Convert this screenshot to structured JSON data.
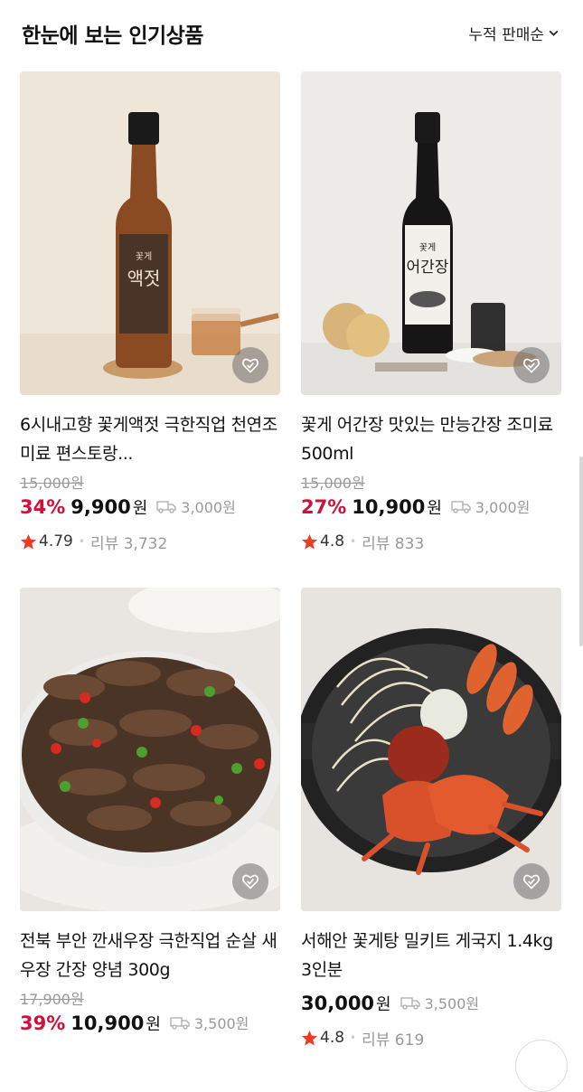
{
  "header": {
    "title": "한눈에 보는 인기상품",
    "sort_label": "누적 판매순"
  },
  "products": [
    {
      "name": "6시내고향 꽃게액젓 극한직업 천연조미료 편스토랑...",
      "original_price": "15,000원",
      "discount": "34%",
      "price": "9,900",
      "currency": "원",
      "shipping": "3,000원",
      "rating": "4.79",
      "reviews": "리뷰 3,732"
    },
    {
      "name": "꽃게 어간장 맛있는 만능간장 조미료 500ml",
      "original_price": "15,000원",
      "discount": "27%",
      "price": "10,900",
      "currency": "원",
      "shipping": "3,000원",
      "rating": "4.8",
      "reviews": "리뷰 833"
    },
    {
      "name": "전북 부안 깐새우장 극한직업 순살 새우장 간장 양념 300g",
      "original_price": "17,900원",
      "discount": "39%",
      "price": "10,900",
      "currency": "원",
      "shipping": "3,500원",
      "rating": "",
      "reviews": ""
    },
    {
      "name": "서해안 꽃게탕 밀키트 게국지 1.4kg 3인분",
      "original_price": "",
      "discount": "",
      "price": "30,000",
      "currency": "원",
      "shipping": "3,500원",
      "rating": "4.8",
      "reviews": "리뷰 619"
    }
  ],
  "labels": {
    "bottle1_small": "꽃게",
    "bottle1_big": "액젓",
    "bottle2_small": "꽃게",
    "bottle2_big": "어간장"
  },
  "colors": {
    "discount": "#d0103a",
    "star": "#ef3b24"
  },
  "icons": [
    "chevron-down-icon",
    "heart-check-icon",
    "truck-icon",
    "star-icon"
  ]
}
